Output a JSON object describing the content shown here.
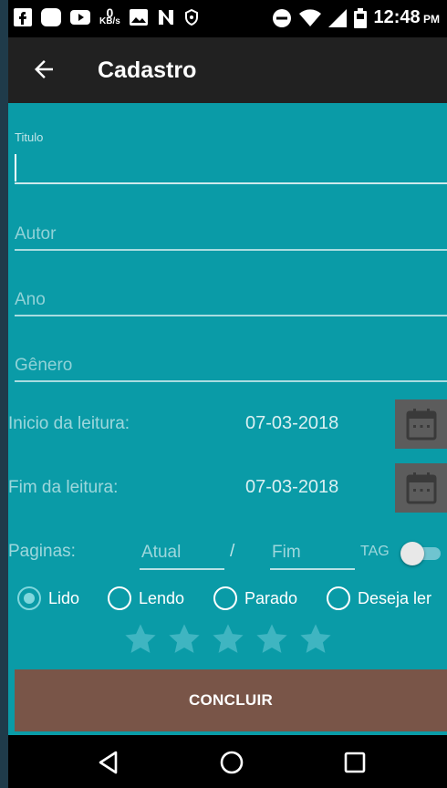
{
  "status_bar": {
    "time": "12:48",
    "ampm": "PM",
    "net_speed_value": "0",
    "net_speed_unit": "KB/s",
    "icons": [
      "facebook-icon",
      "chat-icon",
      "youtube-icon",
      "kbs-indicator",
      "image-icon",
      "n-icon",
      "shield-icon",
      "dnd-icon",
      "wifi-icon",
      "signal-icon",
      "battery-icon"
    ]
  },
  "app_bar": {
    "title": "Cadastro",
    "back_icon": "arrow-left-icon"
  },
  "form": {
    "titulo_label": "Titulo",
    "autor_placeholder": "Autor",
    "ano_placeholder": "Ano",
    "genero_placeholder": "Gênero",
    "inicio_label": "Inicio da leitura:",
    "inicio_date": "07-03-2018",
    "fim_label": "Fim da leitura:",
    "fim_date": "07-03-2018",
    "paginas_label": "Paginas:",
    "atual_placeholder": "Atual",
    "separator": "/",
    "fim_placeholder": "Fim",
    "tag_label": "TAG",
    "tag_on": false,
    "status_options": [
      {
        "label": "Lido",
        "checked": true
      },
      {
        "label": "Lendo",
        "checked": false
      },
      {
        "label": "Parado",
        "checked": false
      },
      {
        "label": "Deseja ler",
        "checked": false
      }
    ],
    "rating": 0,
    "rating_max": 5,
    "submit_label": "CONCLUIR"
  },
  "colors": {
    "content_bg": "#0a9ba7",
    "app_bar": "#212121",
    "button": "#795548",
    "calendar_button": "#5c5c5c",
    "star_empty": "#3fb5c1"
  },
  "nav_bar": {
    "icons": [
      "back-triangle-icon",
      "home-circle-icon",
      "recents-square-icon"
    ]
  }
}
